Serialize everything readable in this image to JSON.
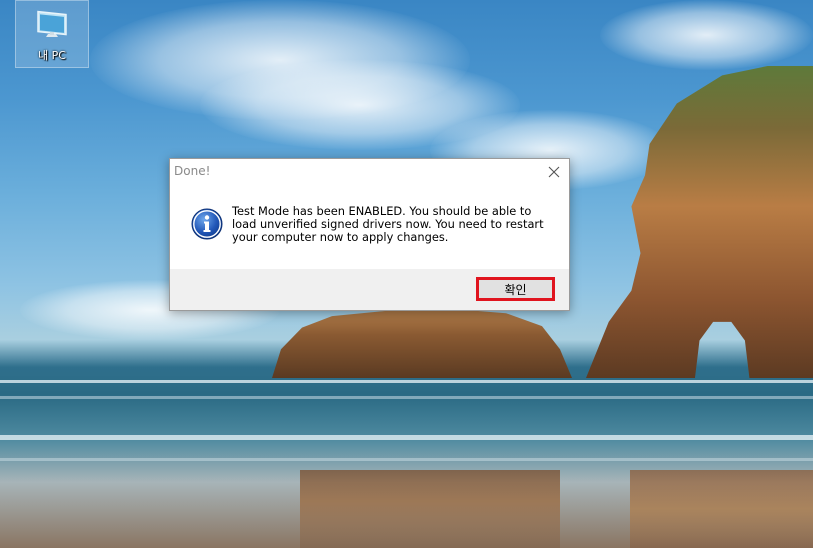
{
  "desktop": {
    "icon_label": "내 PC",
    "icon_name": "computer-icon"
  },
  "dialog": {
    "title": "Done!",
    "message": "Test Mode has been ENABLED. You should be able to load unverified signed drivers now. You need to restart your computer now to apply changes.",
    "icon": "info-icon",
    "ok_label": "확인",
    "close_icon": "close-icon",
    "highlight_color": "#e0141e"
  }
}
